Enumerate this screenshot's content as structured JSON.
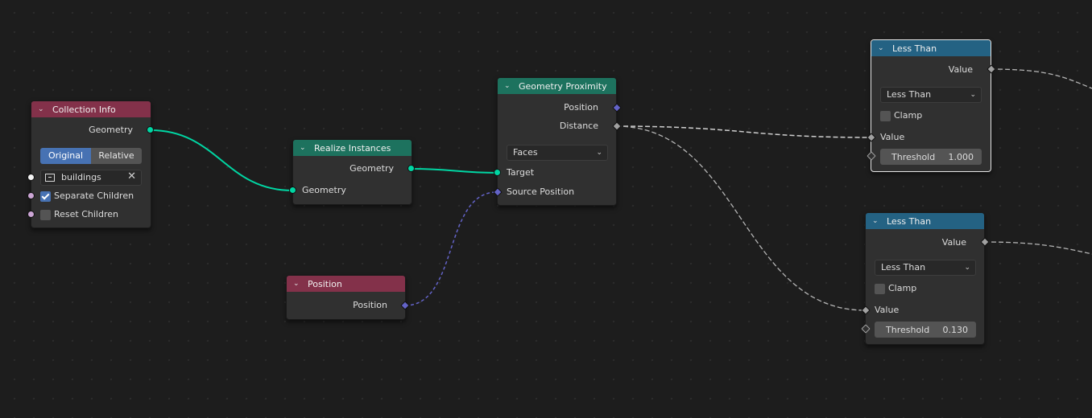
{
  "colors": {
    "geometry_socket": "#00d6a3",
    "vector_socket": "#6363c7",
    "float_socket": "#a1a1a1",
    "collection_socket": "#f5f5f5",
    "bool_socket": "#cca6d6",
    "input_header": "#83314a",
    "geometry_header": "#1d725e",
    "converter_header": "#246283"
  },
  "collection_info": {
    "title": "Collection Info",
    "output_geometry": "Geometry",
    "mode_options": [
      "Original",
      "Relative"
    ],
    "mode_selected": "Original",
    "collection_value": "buildings",
    "collection_icon": "collection-icon",
    "clear_icon": "close-icon",
    "separate_children_label": "Separate Children",
    "separate_children_checked": true,
    "reset_children_label": "Reset Children",
    "reset_children_checked": false
  },
  "realize_instances": {
    "title": "Realize Instances",
    "output_geometry": "Geometry",
    "input_geometry": "Geometry"
  },
  "position": {
    "title": "Position",
    "output_position": "Position"
  },
  "geometry_proximity": {
    "title": "Geometry Proximity",
    "output_position": "Position",
    "output_distance": "Distance",
    "target_element": "Faces",
    "input_target": "Target",
    "input_source_position": "Source Position"
  },
  "less_than_1": {
    "title": "Less Than",
    "output_value": "Value",
    "operation": "Less Than",
    "clamp_label": "Clamp",
    "clamp_checked": false,
    "input_value": "Value",
    "threshold_label": "Threshold",
    "threshold_value": "1.000"
  },
  "less_than_2": {
    "title": "Less Than",
    "output_value": "Value",
    "operation": "Less Than",
    "clamp_label": "Clamp",
    "clamp_checked": false,
    "input_value": "Value",
    "threshold_label": "Threshold",
    "threshold_value": "0.130"
  }
}
